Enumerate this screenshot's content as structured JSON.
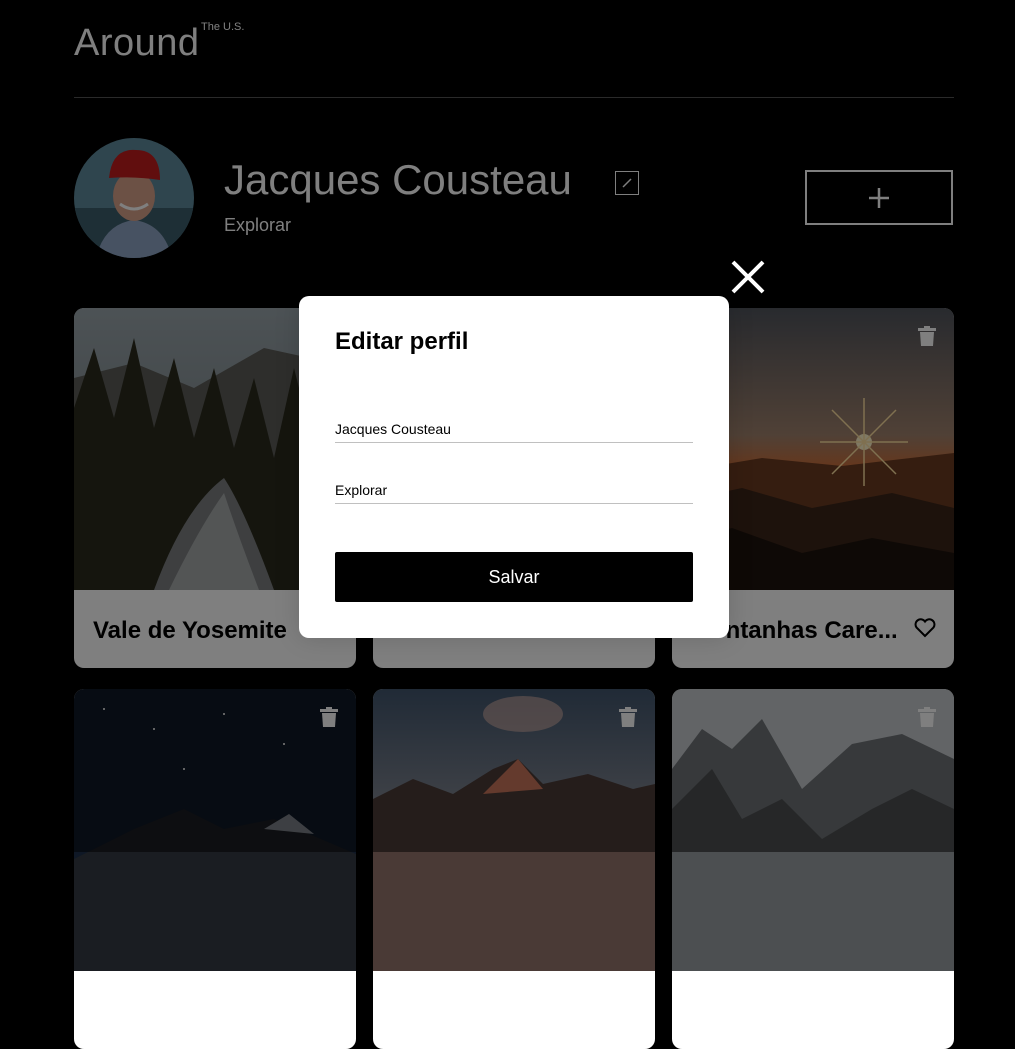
{
  "header": {
    "logo": "Around",
    "logo_sup": "The U.S."
  },
  "profile": {
    "name": "Jacques Cousteau",
    "about": "Explorar",
    "add_button_symbol": "+",
    "avatar_icon": "avatar-photo",
    "edit_icon": "pencil-icon"
  },
  "cards": [
    {
      "title": "Vale de Yosemite"
    },
    {
      "title": ""
    },
    {
      "title": "Montanhas Care..."
    },
    {
      "title": ""
    },
    {
      "title": ""
    },
    {
      "title": ""
    }
  ],
  "modal": {
    "title": "Editar perfil",
    "name_value": "Jacques Cousteau",
    "about_value": "Explorar",
    "save_label": "Salvar",
    "close_icon": "close-icon"
  },
  "colors": {
    "background": "#000000",
    "modal": "#ffffff",
    "overlay": "rgba(0,0,0,0.5)",
    "button": "#000000"
  }
}
